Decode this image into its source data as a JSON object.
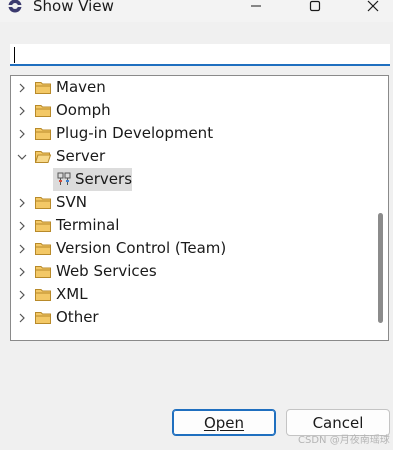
{
  "window": {
    "title": "Show View"
  },
  "filter": {
    "value": ""
  },
  "tree": {
    "items": [
      {
        "label": "Maven",
        "expanded": false,
        "icon": "folder-icon"
      },
      {
        "label": "Oomph",
        "expanded": false,
        "icon": "folder-icon"
      },
      {
        "label": "Plug-in Development",
        "expanded": false,
        "icon": "folder-icon"
      },
      {
        "label": "Server",
        "expanded": true,
        "icon": "folder-icon"
      },
      {
        "label": "Servers",
        "selected": true,
        "icon": "servers-icon"
      },
      {
        "label": "SVN",
        "expanded": false,
        "icon": "folder-icon"
      },
      {
        "label": "Terminal",
        "expanded": false,
        "icon": "folder-icon"
      },
      {
        "label": "Version Control (Team)",
        "expanded": false,
        "icon": "folder-icon"
      },
      {
        "label": "Web Services",
        "expanded": false,
        "icon": "folder-icon"
      },
      {
        "label": "XML",
        "expanded": false,
        "icon": "folder-icon"
      },
      {
        "label": "Other",
        "expanded": false,
        "icon": "folder-icon"
      }
    ]
  },
  "buttons": {
    "open": "Open",
    "cancel": "Cancel"
  },
  "watermark": "CSDN @月夜南瑶球",
  "colors": {
    "accent": "#1f6fbf",
    "folder": "#e8b84a",
    "selection": "#dcdcdc"
  }
}
